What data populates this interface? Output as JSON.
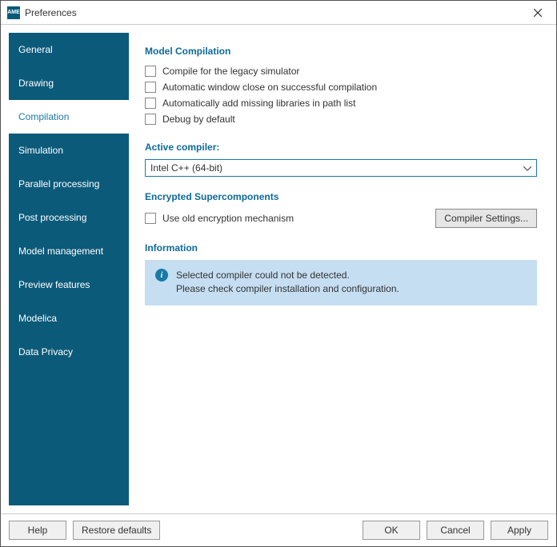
{
  "window": {
    "title": "Preferences",
    "app_icon_text": "AME"
  },
  "sidebar": {
    "items": [
      {
        "label": "General"
      },
      {
        "label": "Drawing"
      },
      {
        "label": "Compilation"
      },
      {
        "label": "Simulation"
      },
      {
        "label": "Parallel processing"
      },
      {
        "label": "Post processing"
      },
      {
        "label": "Model management"
      },
      {
        "label": "Preview features"
      },
      {
        "label": "Modelica"
      },
      {
        "label": "Data Privacy"
      }
    ],
    "active_index": 2
  },
  "main": {
    "model_compilation": {
      "title": "Model Compilation",
      "options": [
        {
          "label": "Compile for the legacy simulator",
          "checked": false
        },
        {
          "label": "Automatic window close on successful compilation",
          "checked": false
        },
        {
          "label": "Automatically add missing libraries in path list",
          "checked": false
        },
        {
          "label": "Debug by default",
          "checked": false
        }
      ]
    },
    "active_compiler": {
      "title": "Active compiler:",
      "value": "Intel C++ (64-bit)"
    },
    "encrypted": {
      "title": "Encrypted Supercomponents",
      "option_label": "Use old encryption mechanism",
      "option_checked": false,
      "settings_button": "Compiler Settings..."
    },
    "information": {
      "title": "Information",
      "line1": "Selected compiler could not be detected.",
      "line2": "Please check compiler installation and configuration."
    }
  },
  "footer": {
    "help": "Help",
    "restore": "Restore defaults",
    "ok": "OK",
    "cancel": "Cancel",
    "apply": "Apply"
  }
}
